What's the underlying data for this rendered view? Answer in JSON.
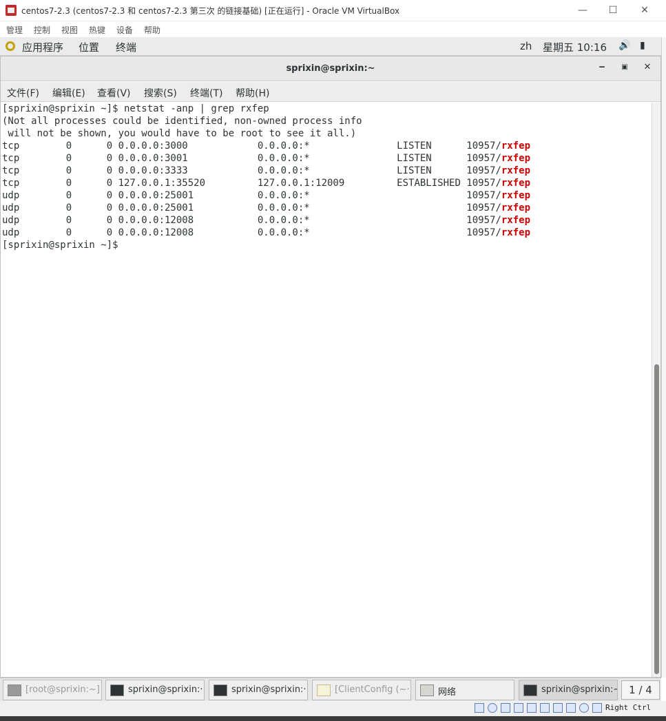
{
  "vbox": {
    "window_title": "centos7-2.3 (centos7-2.3 和 centos7-2.3 第三次 的链接基础) [正在运行] - Oracle VM VirtualBox",
    "menu": [
      "管理",
      "控制",
      "视图",
      "热键",
      "设备",
      "帮助"
    ],
    "status_host_key": "Right Ctrl"
  },
  "gnome_panel": {
    "apps": "应用程序",
    "places": "位置",
    "terminal": "终端",
    "lang": "zh",
    "clock": "星期五 10:16"
  },
  "terminal": {
    "title": "sprixin@sprixin:~",
    "menu": [
      "文件(F)",
      "编辑(E)",
      "查看(V)",
      "搜索(S)",
      "终端(T)",
      "帮助(H)"
    ],
    "prompt_line": "[sprixin@sprixin ~]$ netstat -anp | grep rxfep",
    "info_1": "(Not all processes could be identified, non-owned process info",
    "info_2": " will not be shown, you would have to be root to see it all.)",
    "rows": [
      {
        "text": "tcp        0      0 0.0.0.0:3000            0.0.0.0:*               LISTEN      10957/",
        "proc": "rxfep"
      },
      {
        "text": "tcp        0      0 0.0.0.0:3001            0.0.0.0:*               LISTEN      10957/",
        "proc": "rxfep"
      },
      {
        "text": "tcp        0      0 0.0.0.0:3333            0.0.0.0:*               LISTEN      10957/",
        "proc": "rxfep"
      },
      {
        "text": "tcp        0      0 127.0.0.1:35520         127.0.0.1:12009         ESTABLISHED 10957/",
        "proc": "rxfep"
      },
      {
        "text": "udp        0      0 0.0.0.0:25001           0.0.0.0:*                           10957/",
        "proc": "rxfep"
      },
      {
        "text": "udp        0      0 0.0.0.0:25001           0.0.0.0:*                           10957/",
        "proc": "rxfep"
      },
      {
        "text": "udp        0      0 0.0.0.0:12008           0.0.0.0:*                           10957/",
        "proc": "rxfep"
      },
      {
        "text": "udp        0      0 0.0.0.0:12008           0.0.0.0:*                           10957/",
        "proc": "rxfep"
      }
    ],
    "final_prompt": "[sprixin@sprixin ~]$"
  },
  "taskbar": {
    "tasks": [
      "[root@sprixin:~]",
      "sprixin@sprixin:···",
      "sprixin@sprixin:···",
      "[ClientConfig (~···",
      "网络",
      "sprixin@sprixin:~"
    ],
    "pager": "1 / 4"
  }
}
